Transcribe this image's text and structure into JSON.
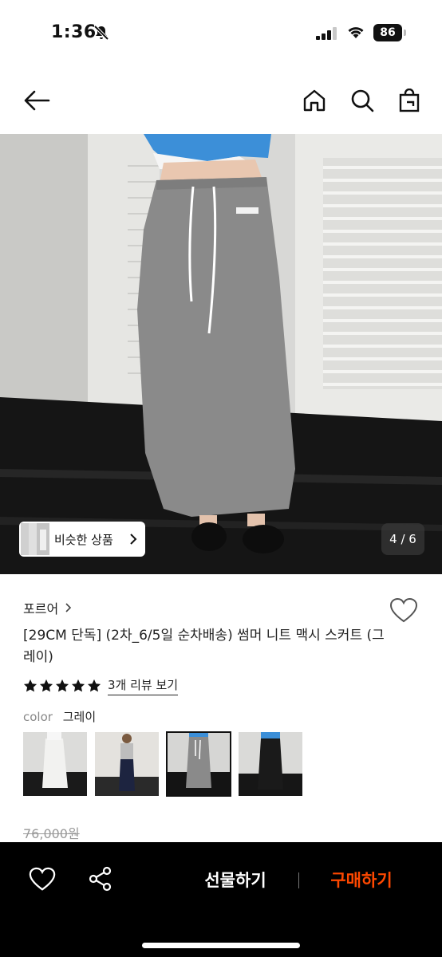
{
  "status": {
    "time": "1:36",
    "battery": "86"
  },
  "product": {
    "brand": "포르어",
    "title": "[29CM 단독] (2차_6/5일 순차배송) 썸머 니트 맥시 스커트 (그레이)",
    "rating_stars": 5,
    "review_link": "3개 리뷰 보기",
    "color_label": "color",
    "color_value": "그레이",
    "original_price": "76,000원",
    "variant_count": 4,
    "selected_variant_index": 2
  },
  "hero": {
    "similar_button": "비슷한 상품",
    "pager": "4 / 6"
  },
  "actions": {
    "gift": "선물하기",
    "buy": "구매하기"
  },
  "colors": {
    "buy_accent": "#ff4800",
    "bottom_bar": "#000000",
    "skirt": "#8a8a8a"
  },
  "icons": [
    "back-arrow-icon",
    "home-icon",
    "search-icon",
    "shopping-bag-icon",
    "heart-icon",
    "share-icon",
    "star-icon",
    "chevron-right-icon"
  ]
}
